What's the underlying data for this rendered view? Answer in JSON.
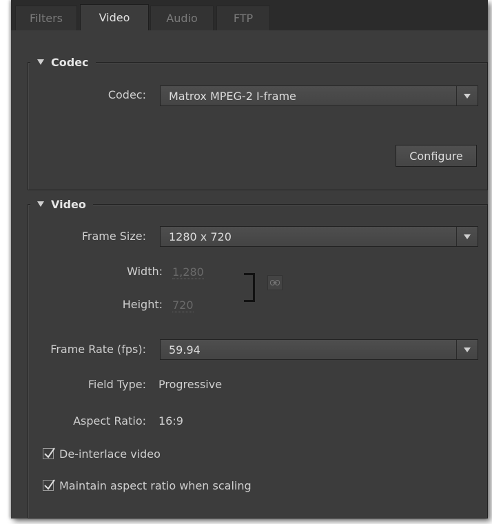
{
  "tabs": [
    {
      "label": "Filters",
      "active": false
    },
    {
      "label": "Video",
      "active": true
    },
    {
      "label": "Audio",
      "active": false
    },
    {
      "label": "FTP",
      "active": false
    }
  ],
  "codec_section": {
    "title": "Codec",
    "codec_label": "Codec:",
    "codec_value": "Matrox MPEG-2 I-frame",
    "configure_label": "Configure"
  },
  "video_section": {
    "title": "Video",
    "frame_size_label": "Frame Size:",
    "frame_size_value": "1280 x 720",
    "width_label": "Width:",
    "width_value": "1,280",
    "height_label": "Height:",
    "height_value": "720",
    "frame_rate_label": "Frame Rate (fps):",
    "frame_rate_value": "59.94",
    "field_type_label": "Field Type:",
    "field_type_value": "Progressive",
    "aspect_ratio_label": "Aspect Ratio:",
    "aspect_ratio_value": "16:9",
    "deinterlace_label": "De-interlace video",
    "deinterlace_checked": true,
    "maintain_aspect_label": "Maintain aspect ratio when scaling",
    "maintain_aspect_checked": true
  },
  "icons": {
    "section_toggle": "triangle-down-icon",
    "dropdown": "chevron-down-icon",
    "constrain_link": "link-icon",
    "checkmark": "checkmark-icon"
  }
}
